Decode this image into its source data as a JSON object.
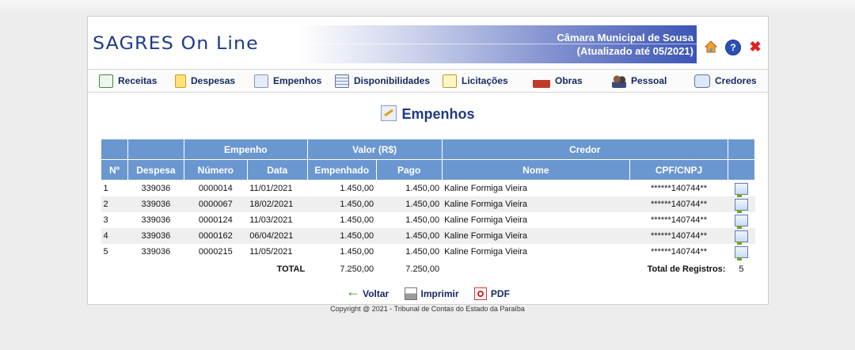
{
  "header": {
    "logo": "SAGRES On Line",
    "org_name": "Câmara Municipal de Sousa",
    "updated": "(Atualizado até 05/2021)"
  },
  "nav": [
    {
      "label": "Receitas",
      "icon": "spreadsheet-icon"
    },
    {
      "label": "Despesas",
      "icon": "notepad-icon"
    },
    {
      "label": "Empenhos",
      "icon": "edit-document-icon"
    },
    {
      "label": "Disponibilidades",
      "icon": "ledger-icon"
    },
    {
      "label": "Licitações",
      "icon": "clipboard-icon"
    },
    {
      "label": "Obras",
      "icon": "construction-icon"
    },
    {
      "label": "Pessoal",
      "icon": "people-icon"
    },
    {
      "label": "Credores",
      "icon": "creditors-icon"
    }
  ],
  "page_title": "Empenhos",
  "table": {
    "group_headers": {
      "empenho": "Empenho",
      "valor": "Valor (R$)",
      "credor": "Credor"
    },
    "columns": {
      "n": "Nº",
      "despesa": "Despesa",
      "numero": "Número",
      "data": "Data",
      "empenhado": "Empenhado",
      "pago": "Pago",
      "nome": "Nome",
      "cpf": "CPF/CNPJ"
    },
    "rows": [
      {
        "n": "1",
        "despesa": "339036",
        "numero": "0000014",
        "data": "11/01/2021",
        "empenhado": "1.450,00",
        "pago": "1.450,00",
        "nome": "Kaline Formiga Vieira",
        "cpf": "******140744**"
      },
      {
        "n": "2",
        "despesa": "339036",
        "numero": "0000067",
        "data": "18/02/2021",
        "empenhado": "1.450,00",
        "pago": "1.450,00",
        "nome": "Kaline Formiga Vieira",
        "cpf": "******140744**"
      },
      {
        "n": "3",
        "despesa": "339036",
        "numero": "0000124",
        "data": "11/03/2021",
        "empenhado": "1.450,00",
        "pago": "1.450,00",
        "nome": "Kaline Formiga Vieira",
        "cpf": "******140744**"
      },
      {
        "n": "4",
        "despesa": "339036",
        "numero": "0000162",
        "data": "06/04/2021",
        "empenhado": "1.450,00",
        "pago": "1.450,00",
        "nome": "Kaline Formiga Vieira",
        "cpf": "******140744**"
      },
      {
        "n": "5",
        "despesa": "339036",
        "numero": "0000215",
        "data": "11/05/2021",
        "empenhado": "1.450,00",
        "pago": "1.450,00",
        "nome": "Kaline Formiga Vieira",
        "cpf": "******140744**"
      }
    ],
    "total_label": "TOTAL",
    "total_empenhado": "7.250,00",
    "total_pago": "7.250,00",
    "total_registros_label": "Total de Registros:",
    "total_registros": "5"
  },
  "actions": {
    "back": "Voltar",
    "print": "Imprimir",
    "pdf": "PDF"
  },
  "copyright": "Copyright @ 2021 - Tribunal de Contas do Estado da Paraíba",
  "colors": {
    "header_blue": "#6b97d0",
    "nav_text": "#14285e",
    "close_red": "#e02020"
  }
}
